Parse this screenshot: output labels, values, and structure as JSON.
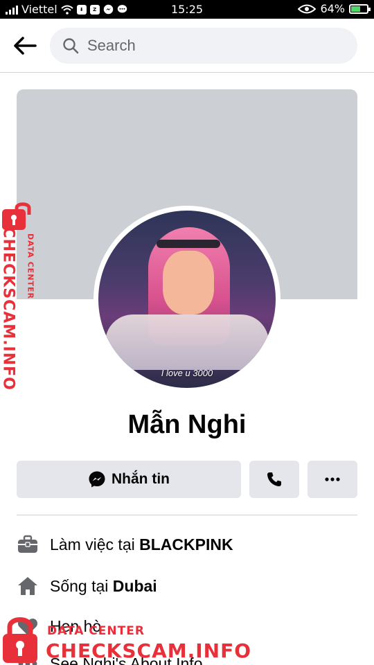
{
  "status_bar": {
    "carrier": "Viettel",
    "time": "15:25",
    "battery_text": "64%",
    "battery_level": 0.64,
    "icons": [
      "signal-icon",
      "wifi-icon",
      "download-icon",
      "zalo-icon",
      "messenger-icon",
      "chat-icon",
      "eye-icon",
      "battery-icon"
    ],
    "battery_color": "#4cd964"
  },
  "header": {
    "back_icon": "arrow-left-icon",
    "search_placeholder": "Search"
  },
  "profile": {
    "name": "Mẫn Nghi",
    "avatar_caption": "I love u 3000",
    "cover_color": "#ccd0d5"
  },
  "actions": {
    "message_label": "Nhắn tin",
    "message_icon": "messenger-icon",
    "call_icon": "phone-icon",
    "more_icon": "more-icon"
  },
  "info": [
    {
      "icon": "briefcase-icon",
      "prefix": "Làm việc tại ",
      "value": "BLACKPINK"
    },
    {
      "icon": "home-icon",
      "prefix": "Sống tại ",
      "value": "Dubai"
    },
    {
      "icon": "heart-icon",
      "prefix": "Hẹn hò",
      "value": ""
    },
    {
      "icon": "more-horizontal-icon",
      "prefix": "See Nghi's About Info",
      "value": ""
    }
  ],
  "watermark": {
    "sub": "DATA CENTER",
    "main": "CHECKSCAM.INFO",
    "color": "#e8303a"
  }
}
